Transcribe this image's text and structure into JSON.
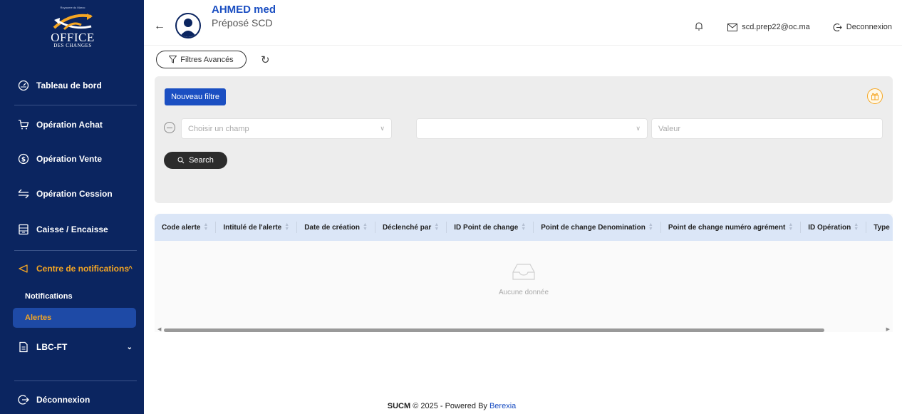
{
  "sidebar": {
    "logo": {
      "kingdom": "Royaume du Maroc",
      "office": "OFFICE",
      "changes": "DES CHANGES"
    },
    "items": [
      {
        "label": "Tableau de bord",
        "icon": "dashboard-icon"
      },
      {
        "label": "Opération Achat",
        "icon": "cart-icon"
      },
      {
        "label": "Opération Vente",
        "icon": "dollar-icon"
      },
      {
        "label": "Opération Cession",
        "icon": "transfer-icon"
      },
      {
        "label": "Caisse / Encaisse",
        "icon": "register-icon"
      },
      {
        "label": "Centre de notifications",
        "icon": "megaphone-icon",
        "expanded": true
      },
      {
        "label": "LBC-FT",
        "icon": "document-icon"
      }
    ],
    "subitems": [
      {
        "label": "Notifications"
      },
      {
        "label": "Alertes",
        "active": true
      }
    ],
    "logout": "Déconnexion"
  },
  "header": {
    "user_name": "AHMED med",
    "user_role": "Préposé SCD",
    "email": "scd.prep22@oc.ma",
    "logout": "Deconnexion"
  },
  "toolbar": {
    "filters_label": "Filtres Avancés"
  },
  "filters": {
    "new_filter_label": "Nouveau filtre",
    "field_placeholder": "Choisir un champ",
    "operator_placeholder": "",
    "value_placeholder": "Valeur",
    "search_label": "Search"
  },
  "table": {
    "columns": [
      "Code alerte",
      "Intitulé de l'alerte",
      "Date de création",
      "Déclenché par",
      "ID Point de change",
      "Point de change Denomination",
      "Point de change numéro agrément",
      "ID Opération",
      "Type"
    ],
    "empty_text": "Aucune donnée"
  },
  "footer": {
    "app": "SUCM",
    "copyright": "© 2025 - Powered By",
    "brand": "Berexia"
  },
  "colors": {
    "sidebar_bg": "#0b2560",
    "accent": "#1b4fc2",
    "active_text": "#f5a623"
  }
}
